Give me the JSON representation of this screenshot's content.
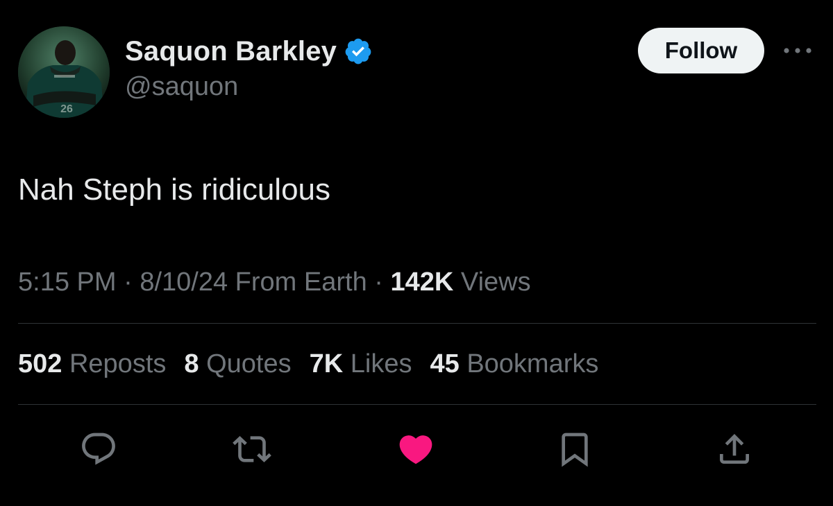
{
  "author": {
    "display_name": "Saquon Barkley",
    "handle": "@saquon",
    "verified": true,
    "avatar_icon": "player-avatar"
  },
  "header": {
    "follow_label": "Follow",
    "more_icon": "more-horizontal-icon"
  },
  "tweet": {
    "text": "Nah Steph is ridiculous"
  },
  "meta": {
    "time": "5:15 PM",
    "separator": " · ",
    "date": "8/10/24",
    "location": "From Earth",
    "separator2": " · ",
    "views_count": "142K",
    "views_label": "Views"
  },
  "stats": {
    "reposts_count": "502",
    "reposts_label": "Reposts",
    "quotes_count": "8",
    "quotes_label": "Quotes",
    "likes_count": "7K",
    "likes_label": "Likes",
    "bookmarks_count": "45",
    "bookmarks_label": "Bookmarks"
  },
  "actions": {
    "reply_icon": "reply-icon",
    "repost_icon": "repost-icon",
    "like_icon": "heart-icon",
    "bookmark_icon": "bookmark-icon",
    "share_icon": "share-icon",
    "liked": true
  },
  "colors": {
    "background": "#000000",
    "primary_text": "#e7e9ea",
    "secondary_text": "#71767b",
    "verified_blue": "#1d9bf0",
    "like_pink": "#f91880",
    "follow_bg": "#eff3f4",
    "divider": "#2f3336"
  }
}
